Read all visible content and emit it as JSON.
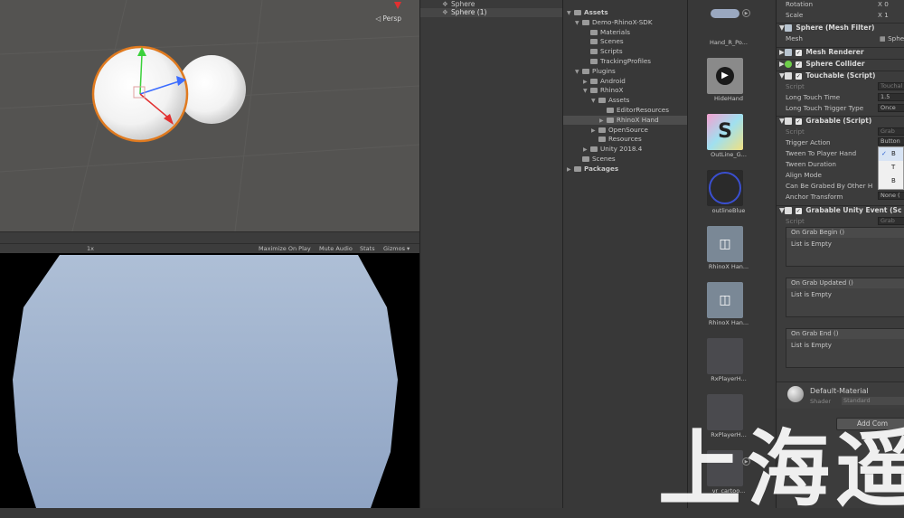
{
  "scene": {
    "persp_label": "◁ Persp"
  },
  "game_bar": {
    "scale_label": "1x",
    "maximize_on_play": "Maximize On Play",
    "mute_audio": "Mute Audio",
    "stats": "Stats",
    "gizmos": "Gizmos ▾"
  },
  "hierarchy": {
    "items": [
      {
        "label": "Sphere",
        "selected": false
      },
      {
        "label": "Sphere (1)",
        "selected": true
      }
    ]
  },
  "project": {
    "tree": [
      {
        "label": "Assets",
        "depth": 0,
        "bold": true,
        "arrow": "▼"
      },
      {
        "label": "Demo-RhinoX-SDK",
        "depth": 1,
        "arrow": "▼"
      },
      {
        "label": "Materials",
        "depth": 2,
        "arrow": ""
      },
      {
        "label": "Scenes",
        "depth": 2,
        "arrow": ""
      },
      {
        "label": "Scripts",
        "depth": 2,
        "arrow": ""
      },
      {
        "label": "TrackingProfiles",
        "depth": 2,
        "arrow": ""
      },
      {
        "label": "Plugins",
        "depth": 1,
        "arrow": "▼"
      },
      {
        "label": "Android",
        "depth": 2,
        "arrow": "▶"
      },
      {
        "label": "RhinoX",
        "depth": 2,
        "arrow": "▼"
      },
      {
        "label": "Assets",
        "depth": 3,
        "arrow": "▼"
      },
      {
        "label": "EditorResources",
        "depth": 4,
        "arrow": ""
      },
      {
        "label": "RhinoX Hand",
        "depth": 4,
        "arrow": "▶",
        "selected": true
      },
      {
        "label": "OpenSource",
        "depth": 3,
        "arrow": "▶"
      },
      {
        "label": "Resources",
        "depth": 3,
        "arrow": ""
      },
      {
        "label": "Unity 2018.4",
        "depth": 2,
        "arrow": "▶"
      },
      {
        "label": "Scenes",
        "depth": 1,
        "arrow": ""
      },
      {
        "label": "Packages",
        "depth": 0,
        "bold": true,
        "arrow": "▶"
      }
    ],
    "assets": [
      {
        "label": "Hand_R_Po...",
        "kind": "hand"
      },
      {
        "label": "HideHand",
        "kind": "play"
      },
      {
        "label": "OutLine_G...",
        "kind": "shader"
      },
      {
        "label": "outlineBlue",
        "kind": "material"
      },
      {
        "label": "RhinoX Han...",
        "kind": "prefab-plus"
      },
      {
        "label": "RhinoX Han...",
        "kind": "prefab"
      },
      {
        "label": "RxPlayerH...",
        "kind": "dark"
      },
      {
        "label": "RxPlayerH...",
        "kind": "dark"
      },
      {
        "label": "vr_cartoo...",
        "kind": "dark"
      }
    ]
  },
  "inspector": {
    "rotation_label": "Rotation",
    "rotation_x": "X  0",
    "scale_label": "Scale",
    "scale_x": "X  1",
    "mesh_filter_title": "Sphere (Mesh Filter)",
    "mesh_label": "Mesh",
    "mesh_value": "▦ Sphere",
    "mesh_renderer_title": "Mesh Renderer",
    "sphere_collider_title": "Sphere Collider",
    "touchable_title": "Touchable (Script)",
    "touchable_script_label": "Script",
    "touchable_script_value": "Touchal",
    "long_touch_time_label": "Long Touch Time",
    "long_touch_time_value": "1.5",
    "long_touch_trigger_label": "Long Touch Trigger Type",
    "long_touch_trigger_value": "Once",
    "grabable_title": "Grabable (Script)",
    "grabable_script_label": "Script",
    "grabable_script_value": "Grab",
    "trigger_action_label": "Trigger Action",
    "trigger_action_value": "Button",
    "tween_label": "Tween To Player Hand",
    "tween_duration_label": "Tween Duration",
    "align_mode_label": "Align Mode",
    "grabbed_by_other_label": "Can Be Grabed By Other H",
    "anchor_label": "Anchor Transform",
    "anchor_value": "None (",
    "event_title": "Grabable Unity Event (Sc",
    "event_script_label": "Script",
    "event_script_value": "Grab",
    "events": [
      {
        "title": "On Grab Begin ()",
        "body": "List is Empty"
      },
      {
        "title": "On Grab Updated ()",
        "body": "List is Empty"
      },
      {
        "title": "On Grab End ()",
        "body": "List is Empty"
      }
    ],
    "material_name": "Default-Material",
    "shader_label": "Shader",
    "shader_value": "Standard",
    "add_component": "Add Com"
  },
  "dropdown": {
    "options": [
      {
        "label": "B",
        "checked": true
      },
      {
        "label": "T",
        "checked": false
      },
      {
        "label": "B",
        "checked": false
      }
    ]
  },
  "watermark": "上海遥"
}
